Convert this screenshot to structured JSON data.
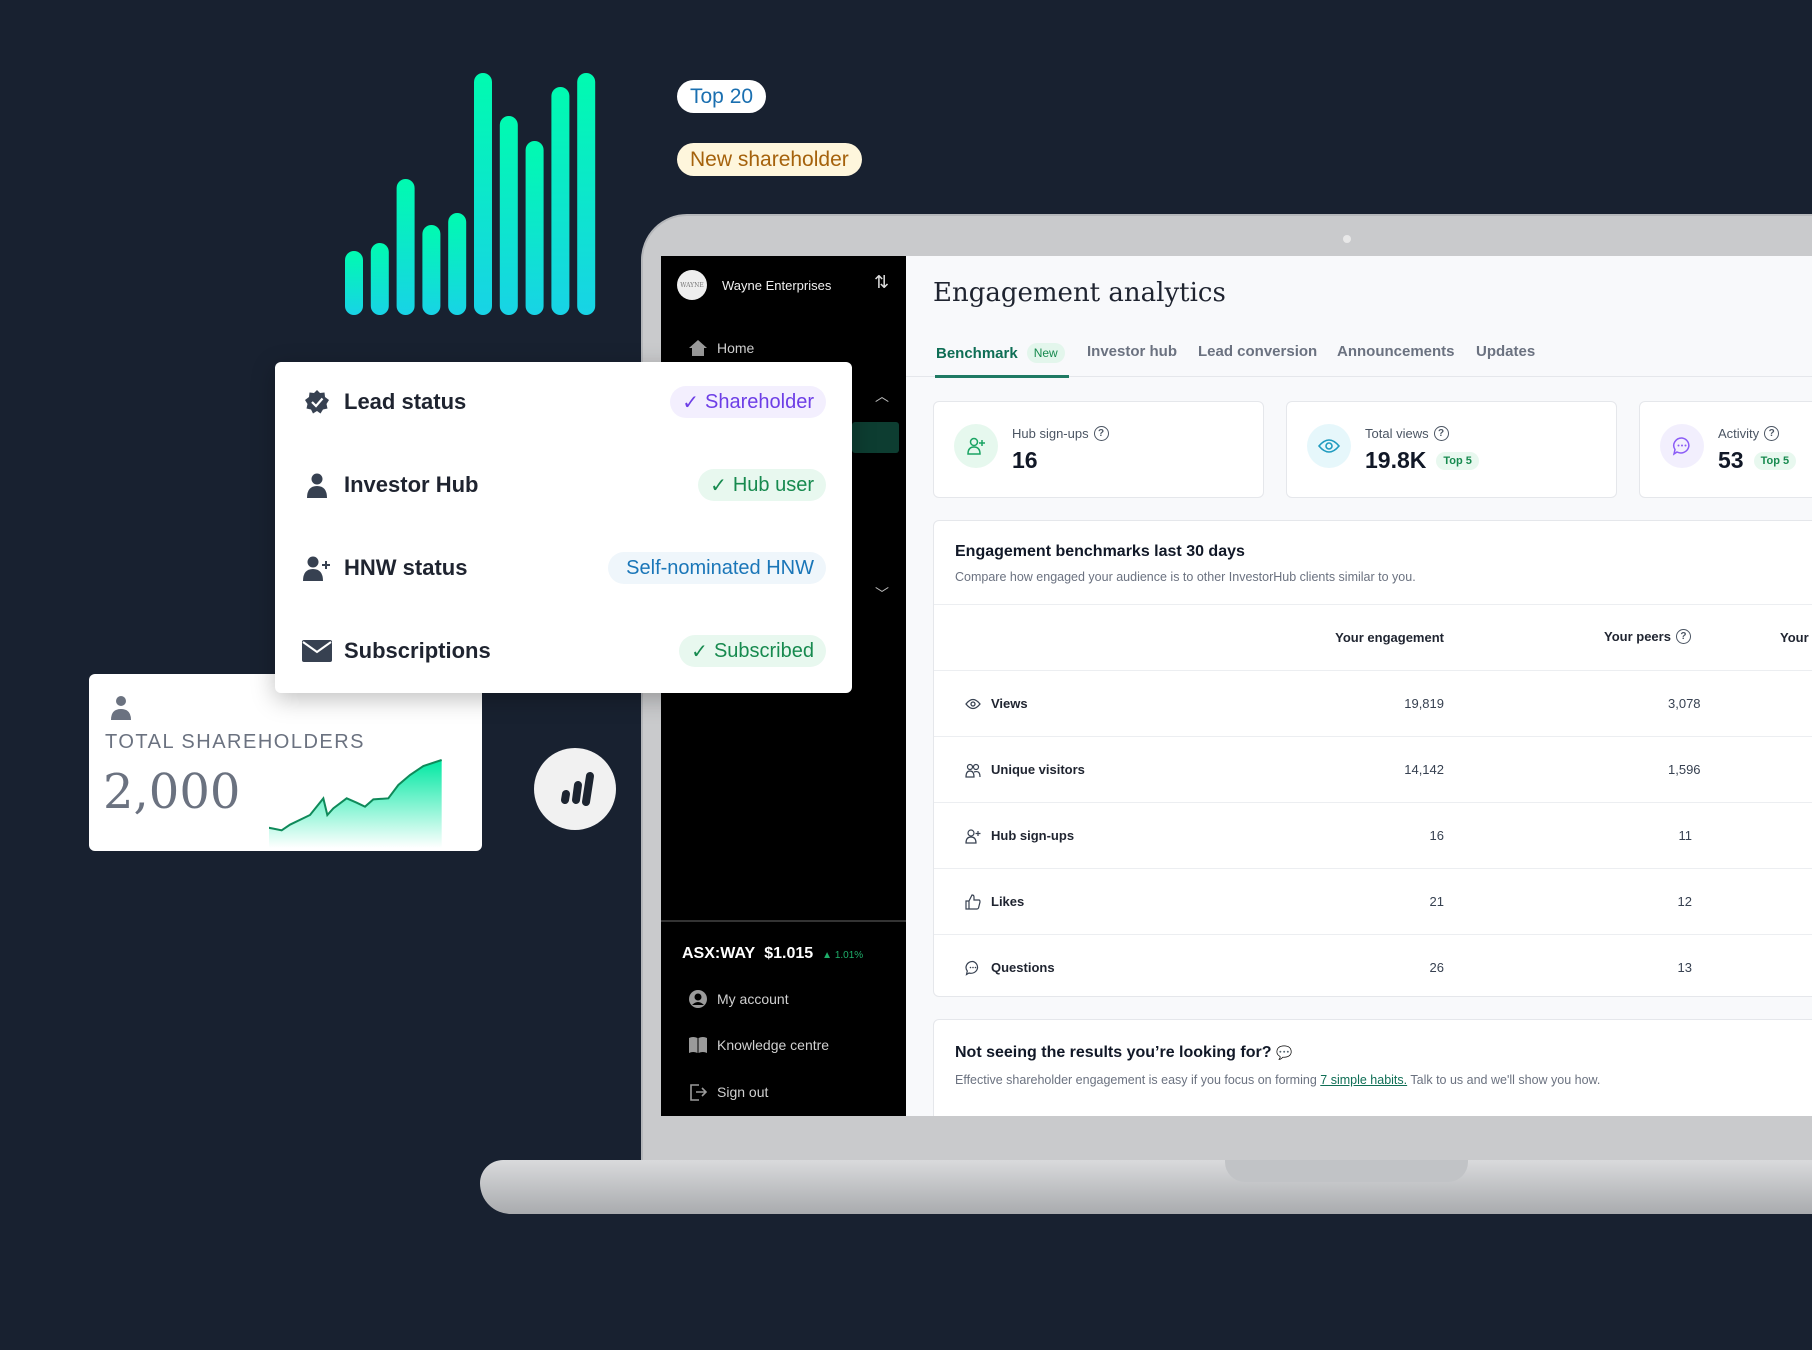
{
  "colors": {
    "background": "#182130",
    "accent_green": "#00f5b0",
    "brand_green": "#0f6e55",
    "purple": "#6d3ee6",
    "blue": "#1a76b8"
  },
  "floating_pills": {
    "top20": "Top 20",
    "new_shareholder": "New shareholder"
  },
  "lead_card": {
    "rows": [
      {
        "icon": "verified-badge-icon",
        "label": "Lead status",
        "badge": "Shareholder",
        "check": "✓"
      },
      {
        "icon": "person-icon",
        "label": "Investor Hub",
        "badge": "Hub user",
        "check": "✓"
      },
      {
        "icon": "person-plus-icon",
        "label": "HNW status",
        "badge": "Self-nominated HNW",
        "check": ""
      },
      {
        "icon": "envelope-icon",
        "label": "Subscriptions",
        "badge": "Subscribed",
        "check": "✓"
      }
    ]
  },
  "shareholders_card": {
    "label": "TOTAL SHAREHOLDERS",
    "value": "2,000"
  },
  "sidebar": {
    "company": "Wayne Enterprises",
    "logo_text": "WAYNE",
    "home": "Home",
    "ticker": "ASX:WAY",
    "price": "$1.015",
    "change": "▲ 1.01%",
    "bottom_items": [
      {
        "label": "My account",
        "icon": "account-icon"
      },
      {
        "label": "Knowledge centre",
        "icon": "book-icon"
      },
      {
        "label": "Sign out",
        "icon": "sign-out-icon"
      }
    ]
  },
  "main": {
    "title": "Engagement analytics",
    "tabs": [
      {
        "label": "Benchmark",
        "active": true,
        "badge": "New"
      },
      {
        "label": "Investor hub"
      },
      {
        "label": "Lead conversion"
      },
      {
        "label": "Announcements"
      },
      {
        "label": "Updates"
      }
    ],
    "stats": [
      {
        "label": "Hub sign-ups",
        "value": "16",
        "badge": "",
        "icon": "user-plus-icon"
      },
      {
        "label": "Total views",
        "value": "19.8K",
        "badge": "Top 5",
        "icon": "eye-icon"
      },
      {
        "label": "Activity",
        "value": "53",
        "badge": "Top 5",
        "icon": "chat-icon"
      }
    ],
    "benchmarks": {
      "title": "Engagement benchmarks last 30 days",
      "subtitle": "Compare how engaged your audience is to other InvestorHub clients similar to you.",
      "columns": [
        "Your engagement",
        "Your peers",
        "Your"
      ],
      "rows": [
        {
          "label": "Views",
          "icon": "eye-icon",
          "yours": "19,819",
          "peers": "3,078"
        },
        {
          "label": "Unique visitors",
          "icon": "users-icon",
          "yours": "14,142",
          "peers": "1,596"
        },
        {
          "label": "Hub sign-ups",
          "icon": "user-plus-icon",
          "yours": "16",
          "peers": "11"
        },
        {
          "label": "Likes",
          "icon": "thumbs-up-icon",
          "yours": "21",
          "peers": "12"
        },
        {
          "label": "Questions",
          "icon": "chat-icon",
          "yours": "26",
          "peers": "13"
        }
      ]
    },
    "help": {
      "title": "Not seeing the results you’re looking for?",
      "text_before": "Effective shareholder engagement is easy if you focus on forming ",
      "link": "7 simple habits.",
      "text_after": " Talk to us and we'll show you how."
    }
  }
}
